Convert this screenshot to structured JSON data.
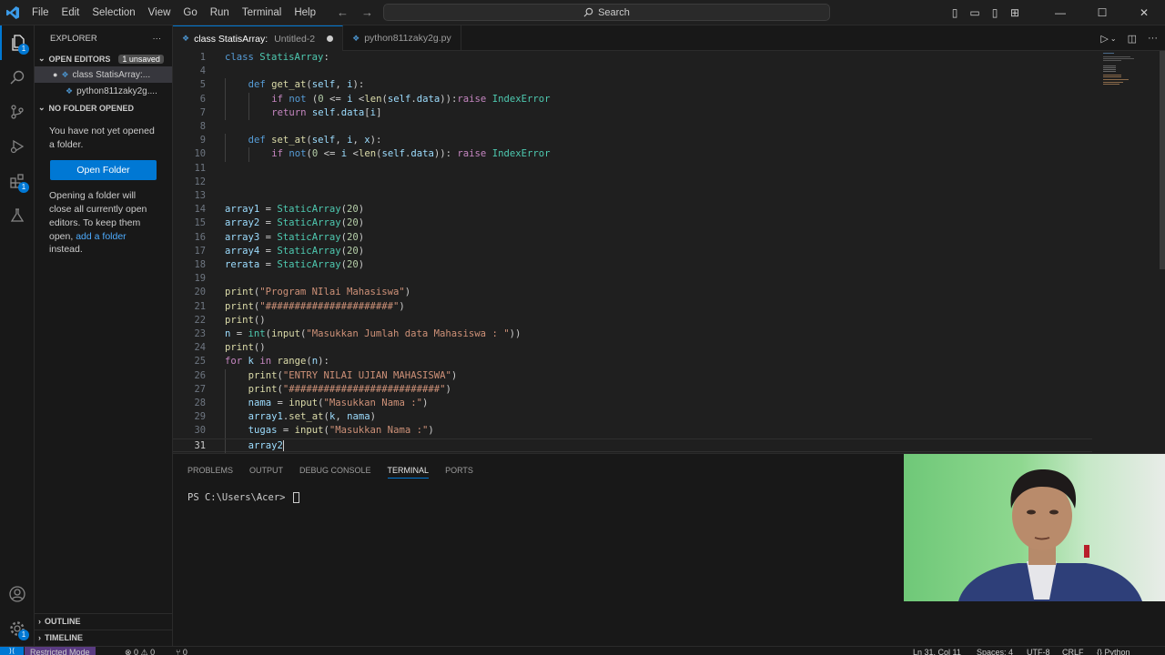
{
  "titlebar": {
    "menu": [
      "File",
      "Edit",
      "Selection",
      "View",
      "Go",
      "Run",
      "Terminal",
      "Help"
    ],
    "search_label": "Search"
  },
  "activity": {
    "explorer_badge": "1",
    "extensions_badge": "1"
  },
  "sidebar": {
    "title": "EXPLORER",
    "open_editors": {
      "label": "OPEN EDITORS",
      "badge": "1 unsaved",
      "items": [
        "class StatisArray:...",
        "python811zaky2g...."
      ]
    },
    "no_folder": {
      "label": "NO FOLDER OPENED",
      "message": "You have not yet opened a folder.",
      "button": "Open Folder",
      "info_pre": "Opening a folder will close all currently open editors. To keep them open,",
      "info_link": "add a folder",
      "info_post": "instead."
    },
    "outline": "OUTLINE",
    "timeline": "TIMELINE"
  },
  "tabs": [
    {
      "label": "class StatisArray:",
      "desc": "Untitled-2",
      "active": true,
      "dirty": true
    },
    {
      "label": "python811zaky2g.py",
      "desc": "",
      "active": false,
      "dirty": false
    }
  ],
  "editor": {
    "current_line": 31,
    "lines": [
      {
        "n": "1",
        "tokens": [
          [
            "k",
            "class"
          ],
          [
            "p",
            " "
          ],
          [
            "c",
            "StatisArray"
          ],
          [
            "p",
            ":"
          ]
        ]
      },
      {
        "n": "4",
        "tokens": []
      },
      {
        "n": "5",
        "indent": 1,
        "tokens": [
          [
            "k",
            "def"
          ],
          [
            "p",
            " "
          ],
          [
            "f",
            "get_at"
          ],
          [
            "p",
            "("
          ],
          [
            "v",
            "self"
          ],
          [
            "p",
            ", "
          ],
          [
            "v",
            "i"
          ],
          [
            "p",
            "):"
          ]
        ]
      },
      {
        "n": "6",
        "indent": 2,
        "tokens": [
          [
            "kc",
            "if"
          ],
          [
            "p",
            " "
          ],
          [
            "k",
            "not"
          ],
          [
            "p",
            " ("
          ],
          [
            "n",
            "0"
          ],
          [
            "p",
            " <= "
          ],
          [
            "v",
            "i"
          ],
          [
            "p",
            " <"
          ],
          [
            "f",
            "len"
          ],
          [
            "p",
            "("
          ],
          [
            "v",
            "self"
          ],
          [
            "p",
            "."
          ],
          [
            "v",
            "data"
          ],
          [
            "p",
            "))"
          ],
          [
            "p",
            ":"
          ],
          [
            "kc",
            "raise"
          ],
          [
            "p",
            " "
          ],
          [
            "c",
            "IndexError"
          ]
        ]
      },
      {
        "n": "7",
        "indent": 2,
        "tokens": [
          [
            "kc",
            "return"
          ],
          [
            "p",
            " "
          ],
          [
            "v",
            "self"
          ],
          [
            "p",
            "."
          ],
          [
            "v",
            "data"
          ],
          [
            "p",
            "["
          ],
          [
            "v",
            "i"
          ],
          [
            "p",
            "]"
          ]
        ]
      },
      {
        "n": "8",
        "tokens": []
      },
      {
        "n": "9",
        "indent": 1,
        "tokens": [
          [
            "k",
            "def"
          ],
          [
            "p",
            " "
          ],
          [
            "f",
            "set_at"
          ],
          [
            "p",
            "("
          ],
          [
            "v",
            "self"
          ],
          [
            "p",
            ", "
          ],
          [
            "v",
            "i"
          ],
          [
            "p",
            ", "
          ],
          [
            "v",
            "x"
          ],
          [
            "p",
            "):"
          ]
        ]
      },
      {
        "n": "10",
        "indent": 2,
        "tokens": [
          [
            "kc",
            "if"
          ],
          [
            "p",
            " "
          ],
          [
            "k",
            "not"
          ],
          [
            "p",
            "("
          ],
          [
            "n",
            "0"
          ],
          [
            "p",
            " <= "
          ],
          [
            "v",
            "i"
          ],
          [
            "p",
            " <"
          ],
          [
            "f",
            "len"
          ],
          [
            "p",
            "("
          ],
          [
            "v",
            "self"
          ],
          [
            "p",
            "."
          ],
          [
            "v",
            "data"
          ],
          [
            "p",
            "))"
          ],
          [
            "p",
            ": "
          ],
          [
            "kc",
            "raise"
          ],
          [
            "p",
            " "
          ],
          [
            "c",
            "IndexError"
          ]
        ]
      },
      {
        "n": "11",
        "tokens": []
      },
      {
        "n": "12",
        "tokens": []
      },
      {
        "n": "13",
        "tokens": []
      },
      {
        "n": "14",
        "tokens": [
          [
            "v",
            "array1"
          ],
          [
            "p",
            " = "
          ],
          [
            "c",
            "StaticArray"
          ],
          [
            "p",
            "("
          ],
          [
            "n",
            "20"
          ],
          [
            "p",
            ")"
          ]
        ]
      },
      {
        "n": "15",
        "tokens": [
          [
            "v",
            "array2"
          ],
          [
            "p",
            " = "
          ],
          [
            "c",
            "StaticArray"
          ],
          [
            "p",
            "("
          ],
          [
            "n",
            "20"
          ],
          [
            "p",
            ")"
          ]
        ]
      },
      {
        "n": "16",
        "tokens": [
          [
            "v",
            "array3"
          ],
          [
            "p",
            " = "
          ],
          [
            "c",
            "StaticArray"
          ],
          [
            "p",
            "("
          ],
          [
            "n",
            "20"
          ],
          [
            "p",
            ")"
          ]
        ]
      },
      {
        "n": "17",
        "tokens": [
          [
            "v",
            "array4"
          ],
          [
            "p",
            " = "
          ],
          [
            "c",
            "StaticArray"
          ],
          [
            "p",
            "("
          ],
          [
            "n",
            "20"
          ],
          [
            "p",
            ")"
          ]
        ]
      },
      {
        "n": "18",
        "tokens": [
          [
            "v",
            "rerata"
          ],
          [
            "p",
            " = "
          ],
          [
            "c",
            "StaticArray"
          ],
          [
            "p",
            "("
          ],
          [
            "n",
            "20"
          ],
          [
            "p",
            ")"
          ]
        ]
      },
      {
        "n": "19",
        "tokens": []
      },
      {
        "n": "20",
        "tokens": [
          [
            "f",
            "print"
          ],
          [
            "p",
            "("
          ],
          [
            "s",
            "\"Program NIlai Mahasiswa\""
          ],
          [
            "p",
            ")"
          ]
        ]
      },
      {
        "n": "21",
        "tokens": [
          [
            "f",
            "print"
          ],
          [
            "p",
            "("
          ],
          [
            "s",
            "\"######################\""
          ],
          [
            "p",
            ")"
          ]
        ]
      },
      {
        "n": "22",
        "tokens": [
          [
            "f",
            "print"
          ],
          [
            "p",
            "()"
          ]
        ]
      },
      {
        "n": "23",
        "tokens": [
          [
            "v",
            "n"
          ],
          [
            "p",
            " = "
          ],
          [
            "c",
            "int"
          ],
          [
            "p",
            "("
          ],
          [
            "f",
            "input"
          ],
          [
            "p",
            "("
          ],
          [
            "s",
            "\"Masukkan Jumlah data Mahasiswa : \""
          ],
          [
            "p",
            "))"
          ]
        ]
      },
      {
        "n": "24",
        "tokens": [
          [
            "f",
            "print"
          ],
          [
            "p",
            "()"
          ]
        ]
      },
      {
        "n": "25",
        "tokens": [
          [
            "kc",
            "for"
          ],
          [
            "p",
            " "
          ],
          [
            "v",
            "k"
          ],
          [
            "p",
            " "
          ],
          [
            "kc",
            "in"
          ],
          [
            "p",
            " "
          ],
          [
            "f",
            "range"
          ],
          [
            "p",
            "("
          ],
          [
            "v",
            "n"
          ],
          [
            "p",
            "):"
          ]
        ]
      },
      {
        "n": "26",
        "indent": 1,
        "tokens": [
          [
            "f",
            "print"
          ],
          [
            "p",
            "("
          ],
          [
            "s",
            "\"ENTRY NILAI UJIAN MAHASISWA\""
          ],
          [
            "p",
            ")"
          ]
        ]
      },
      {
        "n": "27",
        "indent": 1,
        "tokens": [
          [
            "f",
            "print"
          ],
          [
            "p",
            "("
          ],
          [
            "s",
            "\"##########################\""
          ],
          [
            "p",
            ")"
          ]
        ]
      },
      {
        "n": "28",
        "indent": 1,
        "tokens": [
          [
            "v",
            "nama"
          ],
          [
            "p",
            " = "
          ],
          [
            "f",
            "input"
          ],
          [
            "p",
            "("
          ],
          [
            "s",
            "\"Masukkan Nama :\""
          ],
          [
            "p",
            ")"
          ]
        ]
      },
      {
        "n": "29",
        "indent": 1,
        "tokens": [
          [
            "v",
            "array1"
          ],
          [
            "p",
            "."
          ],
          [
            "f",
            "set_at"
          ],
          [
            "p",
            "("
          ],
          [
            "v",
            "k"
          ],
          [
            "p",
            ", "
          ],
          [
            "v",
            "nama"
          ],
          [
            "p",
            ")"
          ]
        ]
      },
      {
        "n": "30",
        "indent": 1,
        "tokens": [
          [
            "v",
            "tugas"
          ],
          [
            "p",
            " = "
          ],
          [
            "f",
            "input"
          ],
          [
            "p",
            "("
          ],
          [
            "s",
            "\"Masukkan Nama :\""
          ],
          [
            "p",
            ")"
          ]
        ]
      },
      {
        "n": "31",
        "indent": 1,
        "tokens": [
          [
            "v",
            "array2"
          ]
        ]
      }
    ]
  },
  "panel": {
    "tabs": [
      "PROBLEMS",
      "OUTPUT",
      "DEBUG CONSOLE",
      "TERMINAL",
      "PORTS"
    ],
    "active_tab": "TERMINAL",
    "prompt": "PS C:\\Users\\Acer> "
  },
  "statusbar": {
    "restricted": "Restricted Mode",
    "problems": "⊗ 0 ⚠ 0",
    "ports": "⑂ 0",
    "position": "Ln 31, Col 11",
    "spaces": "Spaces: 4",
    "encoding": "UTF-8",
    "eol": "CRLF",
    "language": "{} Python"
  },
  "colors": {
    "accent": "#0078d4",
    "bg": "#1f1f1f",
    "sidebar": "#181818"
  }
}
